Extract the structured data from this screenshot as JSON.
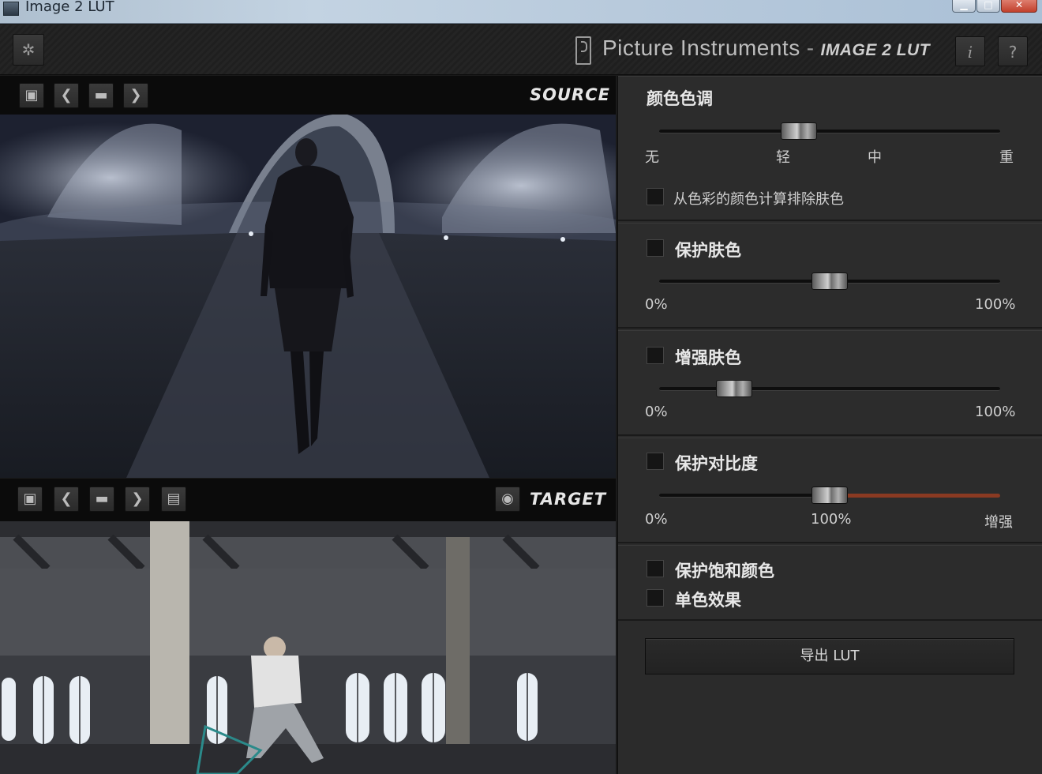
{
  "window": {
    "title": "Image 2 LUT"
  },
  "header": {
    "brand": "Picture Instruments",
    "separator": "-",
    "product": "IMAGE 2 LUT",
    "info_label": "i",
    "help_label": "?"
  },
  "source": {
    "label": "SOURCE"
  },
  "target": {
    "label": "TARGET"
  },
  "panel": {
    "color_tone": {
      "title": "颜色色调",
      "ticks": [
        "无",
        "轻",
        "中",
        "重"
      ],
      "level": 0.41,
      "exclude_skin_label": "从色彩的颜色计算排除肤色"
    },
    "protect_skin": {
      "title": "保护肤色",
      "min": "0%",
      "max": "100%",
      "value": 0.5
    },
    "enhance_skin": {
      "title": "增强肤色",
      "min": "0%",
      "max": "100%",
      "value": 0.22
    },
    "protect_contrast": {
      "title": "保护对比度",
      "min": "0%",
      "mid": "100%",
      "max": "增强",
      "value": 0.5
    },
    "protect_saturation": {
      "title": "保护饱和颜色"
    },
    "monochrome": {
      "title": "单色效果"
    },
    "export_label": "导出 LUT"
  },
  "colors": {
    "accent_red": "#8a3a22",
    "panel_bg": "#2c2c2c",
    "toolbar_bg": "#0b0b0b"
  },
  "icons": [
    "gear-icon",
    "info-icon",
    "help-icon",
    "reset-icon",
    "prev-icon",
    "folder-icon",
    "next-icon",
    "save-icon",
    "eye-icon"
  ]
}
